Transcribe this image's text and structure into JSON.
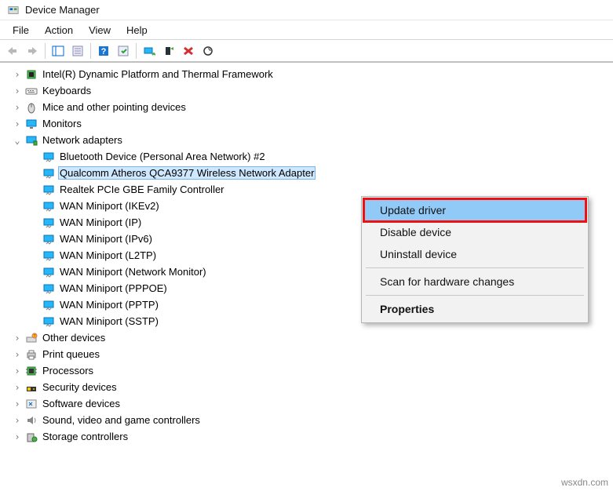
{
  "window": {
    "title": "Device Manager"
  },
  "menubar": [
    "File",
    "Action",
    "View",
    "Help"
  ],
  "tree": [
    {
      "label": "Intel(R) Dynamic Platform and Thermal Framework",
      "icon": "chip",
      "level": 0,
      "toggle": ">",
      "interact": true
    },
    {
      "label": "Keyboards",
      "icon": "keyboard",
      "level": 0,
      "toggle": ">",
      "interact": true
    },
    {
      "label": "Mice and other pointing devices",
      "icon": "mouse",
      "level": 0,
      "toggle": ">",
      "interact": true
    },
    {
      "label": "Monitors",
      "icon": "monitor",
      "level": 0,
      "toggle": ">",
      "interact": true
    },
    {
      "label": "Network adapters",
      "icon": "netadapter",
      "level": 0,
      "toggle": "v",
      "interact": true
    },
    {
      "label": "Bluetooth Device (Personal Area Network) #2",
      "icon": "net",
      "level": 1,
      "toggle": "",
      "interact": true
    },
    {
      "label": "Qualcomm Atheros QCA9377 Wireless Network Adapter",
      "icon": "net",
      "level": 1,
      "toggle": "",
      "interact": true,
      "selected": true
    },
    {
      "label": "Realtek PCIe GBE Family Controller",
      "icon": "net",
      "level": 1,
      "toggle": "",
      "interact": true
    },
    {
      "label": "WAN Miniport (IKEv2)",
      "icon": "net",
      "level": 1,
      "toggle": "",
      "interact": true
    },
    {
      "label": "WAN Miniport (IP)",
      "icon": "net",
      "level": 1,
      "toggle": "",
      "interact": true
    },
    {
      "label": "WAN Miniport (IPv6)",
      "icon": "net",
      "level": 1,
      "toggle": "",
      "interact": true
    },
    {
      "label": "WAN Miniport (L2TP)",
      "icon": "net",
      "level": 1,
      "toggle": "",
      "interact": true
    },
    {
      "label": "WAN Miniport (Network Monitor)",
      "icon": "net",
      "level": 1,
      "toggle": "",
      "interact": true
    },
    {
      "label": "WAN Miniport (PPPOE)",
      "icon": "net",
      "level": 1,
      "toggle": "",
      "interact": true
    },
    {
      "label": "WAN Miniport (PPTP)",
      "icon": "net",
      "level": 1,
      "toggle": "",
      "interact": true
    },
    {
      "label": "WAN Miniport (SSTP)",
      "icon": "net",
      "level": 1,
      "toggle": "",
      "interact": true
    },
    {
      "label": "Other devices",
      "icon": "other",
      "level": 0,
      "toggle": ">",
      "interact": true
    },
    {
      "label": "Print queues",
      "icon": "printer",
      "level": 0,
      "toggle": ">",
      "interact": true
    },
    {
      "label": "Processors",
      "icon": "cpu",
      "level": 0,
      "toggle": ">",
      "interact": true
    },
    {
      "label": "Security devices",
      "icon": "security",
      "level": 0,
      "toggle": ">",
      "interact": true
    },
    {
      "label": "Software devices",
      "icon": "software",
      "level": 0,
      "toggle": ">",
      "interact": true
    },
    {
      "label": "Sound, video and game controllers",
      "icon": "sound",
      "level": 0,
      "toggle": ">",
      "interact": true
    },
    {
      "label": "Storage controllers",
      "icon": "storage",
      "level": 0,
      "toggle": ">",
      "interact": true
    }
  ],
  "context_menu": [
    {
      "label": "Update driver",
      "highlight": true
    },
    {
      "label": "Disable device"
    },
    {
      "label": "Uninstall device"
    },
    {
      "sep": true
    },
    {
      "label": "Scan for hardware changes"
    },
    {
      "sep": true
    },
    {
      "label": "Properties",
      "bold": true
    }
  ],
  "watermark": "wsxdn.com"
}
